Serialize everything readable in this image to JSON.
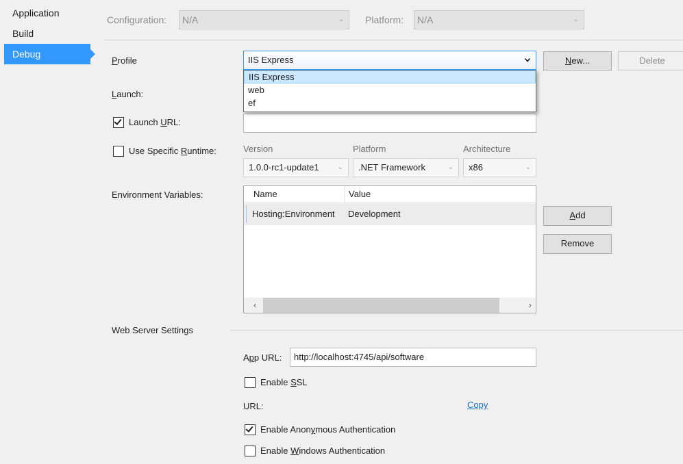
{
  "nav": {
    "items": [
      {
        "label": "Application"
      },
      {
        "label": "Build"
      },
      {
        "label": "Debug"
      }
    ]
  },
  "topbar": {
    "configuration_label": "Configuration:",
    "configuration_value": "N/A",
    "platform_label": "Platform:",
    "platform_value": "N/A"
  },
  "profile": {
    "label_first": "P",
    "label_rest": "rofile",
    "selected": "IIS Express",
    "options": [
      "IIS Express",
      "web",
      "ef"
    ],
    "new_first": "N",
    "new_rest": "ew...",
    "delete_label": "Delete"
  },
  "launch": {
    "label_first": "L",
    "label_rest": "aunch:"
  },
  "launch_url": {
    "label_before": "Launch ",
    "label_ul": "U",
    "label_after": "RL:",
    "checked": true,
    "value": ""
  },
  "runtime": {
    "label_before": "Use Specific ",
    "label_ul": "R",
    "label_after": "untime:",
    "checked": false,
    "version_label": "Version",
    "version_value": "1.0.0-rc1-update1",
    "platform_label": "Platform",
    "platform_value": ".NET Framework",
    "architecture_label": "Architecture",
    "architecture_value": "x86"
  },
  "env": {
    "label": "Environment Variables:",
    "columns": [
      "Name",
      "Value"
    ],
    "rows": [
      {
        "name": "Hosting:Environment",
        "value": "Development"
      }
    ],
    "add_first": "A",
    "add_rest": "dd",
    "remove_label": "Remove"
  },
  "web": {
    "section_label": "Web Server Settings",
    "app_url_first": "A",
    "app_url_ul": "p",
    "app_url_rest": "p URL:",
    "app_url_value": "http://localhost:4745/api/software",
    "ssl_before": "Enable ",
    "ssl_ul": "S",
    "ssl_after": "SL",
    "ssl_checked": false,
    "url_label": "URL:",
    "copy_label": "Copy",
    "anon_before": "Enable Anon",
    "anon_ul": "y",
    "anon_after": "mous Authentication",
    "anon_checked": true,
    "win_before": "Enable ",
    "win_ul": "W",
    "win_after": "indows Authentication",
    "win_checked": false
  },
  "colors": {
    "accent": "#3399ff",
    "link": "#1a6ec7"
  },
  "icons": [
    "chevron-down-icon",
    "check-icon",
    "arrow-left-icon",
    "arrow-right-icon"
  ]
}
